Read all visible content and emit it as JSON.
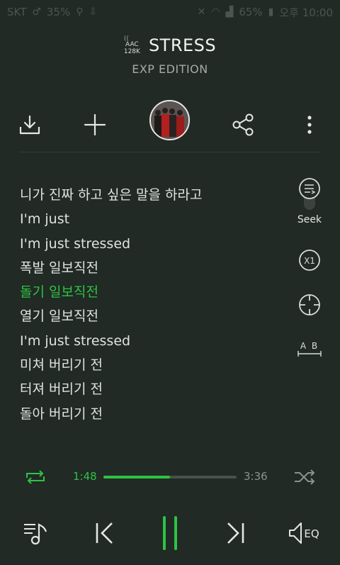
{
  "status_bar": {
    "carrier": "SKT",
    "signal_extra": "35%",
    "battery": "65%",
    "time": "오후 10:00"
  },
  "now_playing": {
    "codec_top": "AAC",
    "codec_bottom": "128K",
    "title": "STRESS",
    "album": "EXP EDITION"
  },
  "lyrics": [
    {
      "text": "니가 진짜 하고 싶은 말을 하라고",
      "active": false
    },
    {
      "text": "I'm just",
      "active": false
    },
    {
      "text": "I'm just stressed",
      "active": false
    },
    {
      "text": "폭발 일보직전",
      "active": false
    },
    {
      "text": "돌기 일보직전",
      "active": true
    },
    {
      "text": "열기 일보직전",
      "active": false
    },
    {
      "text": "I'm just stressed",
      "active": false
    },
    {
      "text": "미쳐 버리기 전",
      "active": false
    },
    {
      "text": "터져 버리기 전",
      "active": false
    },
    {
      "text": "돌아 버리기 전",
      "active": false
    }
  ],
  "side_controls": {
    "seek_label": "Seek",
    "speed_label": "X1",
    "ab_label": "A B"
  },
  "progress": {
    "current": "1:48",
    "total": "3:36",
    "fraction": 0.5
  },
  "bottom": {
    "eq_label": "EQ"
  },
  "colors": {
    "accent": "#2fc244",
    "background": "#212a24"
  }
}
